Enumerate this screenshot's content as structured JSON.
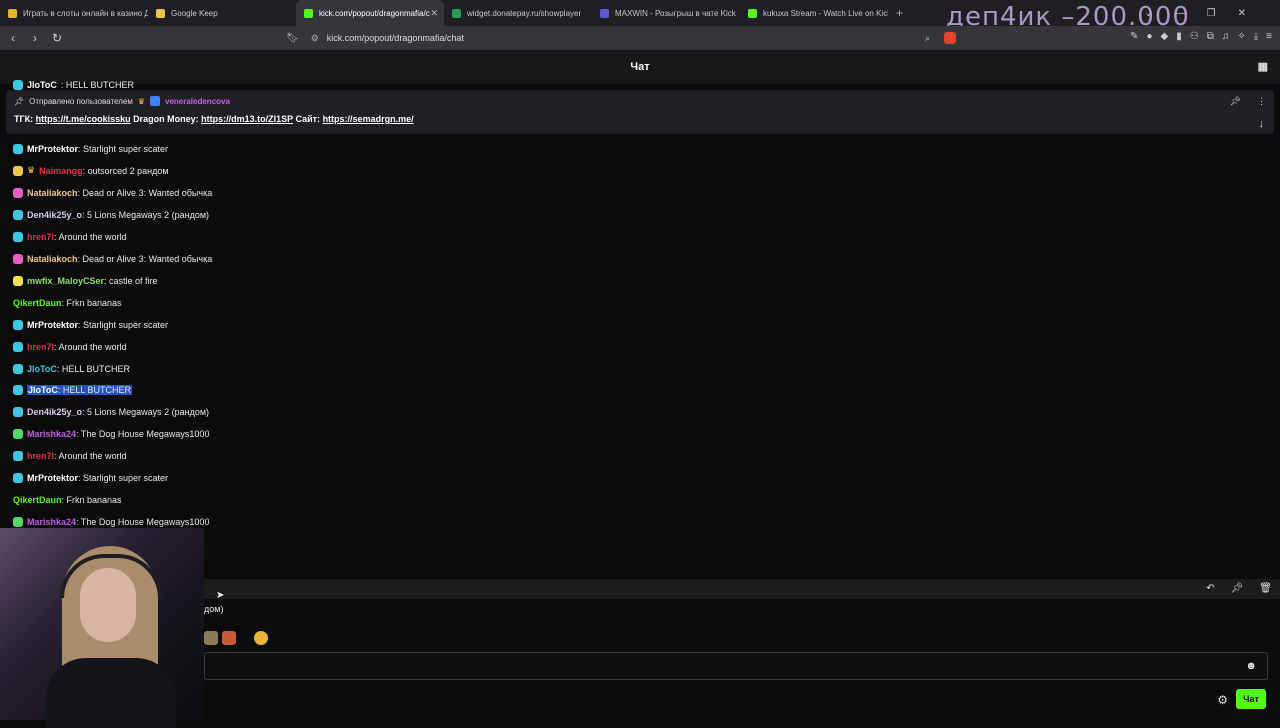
{
  "browser": {
    "tabs": [
      {
        "title": "Играть в слоты онлайн в казино Д",
        "fav_color": "#e5b52c",
        "active": false
      },
      {
        "title": "Google Keep",
        "fav_color": "#f6c443",
        "active": false
      },
      {
        "title": "kick.com/popout/dragonmafia/c",
        "fav_color": "#53fc18",
        "active": true
      },
      {
        "title": "widget.donatepay.ru/showplayer",
        "fav_color": "#2b9a54",
        "active": false
      },
      {
        "title": "MAXWIN - Розыгрыш в чате Kick",
        "fav_color": "#5b5bd6",
        "active": false
      },
      {
        "title": "kukuxa Stream - Watch Live on Kick",
        "fav_color": "#53fc18",
        "active": false
      }
    ],
    "new_tab": "+",
    "url": "kick.com/popout/dragonmafia/chat"
  },
  "overlay": {
    "text": "деп4ик –200.000"
  },
  "chat": {
    "header_title": "Чат",
    "pinned": {
      "label": "Отправлено пользователем",
      "user": "veneraledencova",
      "segments": [
        {
          "text": "ТГК: ",
          "link": false
        },
        {
          "text": "https://t.me/cookissku",
          "link": true
        },
        {
          "text": " Dragon Money: ",
          "link": false
        },
        {
          "text": "https://dm13.to/ZI1SP",
          "link": true
        },
        {
          "text": " Сайт: ",
          "link": false
        },
        {
          "text": "https://semadrgn.me/",
          "link": true
        }
      ]
    },
    "top_partial": {
      "user": "JloToC",
      "text": ": HELL BUTCHER"
    },
    "messages": [
      {
        "user": "MrProtektor",
        "text": ": Starlight super scater",
        "color": "#ffffff",
        "badge": "#3ec7e0"
      },
      {
        "user": "Naimangg",
        "text": ": outsorced 2 рандом",
        "color": "#e0314e",
        "badge": "#f2c94c",
        "crown": true
      },
      {
        "user": "Nataliakoch",
        "text": ": Dead or Alive 3: Wanted обычка",
        "color": "#f2c28a",
        "badge": "#e85cc4"
      },
      {
        "user": "Den4ik25y_o",
        "text": ": 5 Lions Megaways 2 (рандом)",
        "color": "#d8c8f0",
        "badge": "#3ec7e0"
      },
      {
        "user": "hren7l",
        "text": ": Around the world",
        "color": "#e0314e",
        "badge": "#3ec7e0"
      },
      {
        "user": "Nataliakoch",
        "text": ": Dead or Alive 3: Wanted обычка",
        "color": "#f2c28a",
        "badge": "#e85cc4"
      },
      {
        "user": "mwfix_MaloyCSer",
        "text": ": castle of fire",
        "color": "#8fe05a",
        "badge": "#f2e24c"
      },
      {
        "user": "QikertDaun",
        "text": ": Frkn bananas",
        "color": "#53fc18",
        "badge": null
      },
      {
        "user": "MrProtektor",
        "text": ": Starlight super scater",
        "color": "#ffffff",
        "badge": "#3ec7e0"
      },
      {
        "user": "hren7l",
        "text": ": Around the world",
        "color": "#e0314e",
        "badge": "#3ec7e0"
      },
      {
        "user": "JloToC",
        "text": ": HELL BUTCHER",
        "color": "#3ec7e0",
        "badge": "#3ec7e0"
      },
      {
        "user": "JloToC",
        "text": ": HELL BUTCHER",
        "color": "#ffffff",
        "badge": "#3ec7e0",
        "selected": true
      },
      {
        "user": "Den4ik25y_o",
        "text": ": 5 Lions Megaways 2 (рандом)",
        "color": "#d8c8f0",
        "badge": "#3ec7e0"
      },
      {
        "user": "Marishka24",
        "text": ": The Dog House Megaways1000",
        "color": "#c85de8",
        "badge": "#53d769"
      },
      {
        "user": "hren7l",
        "text": ": Around the world",
        "color": "#e0314e",
        "badge": "#3ec7e0"
      },
      {
        "user": "MrProtektor",
        "text": ": Starlight super scater",
        "color": "#ffffff",
        "badge": "#3ec7e0"
      },
      {
        "user": "QikertDaun",
        "text": ": Frkn bananas",
        "color": "#53fc18",
        "badge": null
      },
      {
        "user": "Marishka24",
        "text": ": The Dog House Megaways1000",
        "color": "#c85de8",
        "badge": "#53d769"
      }
    ],
    "partial_line": "дом)",
    "send_label": "Чат"
  }
}
